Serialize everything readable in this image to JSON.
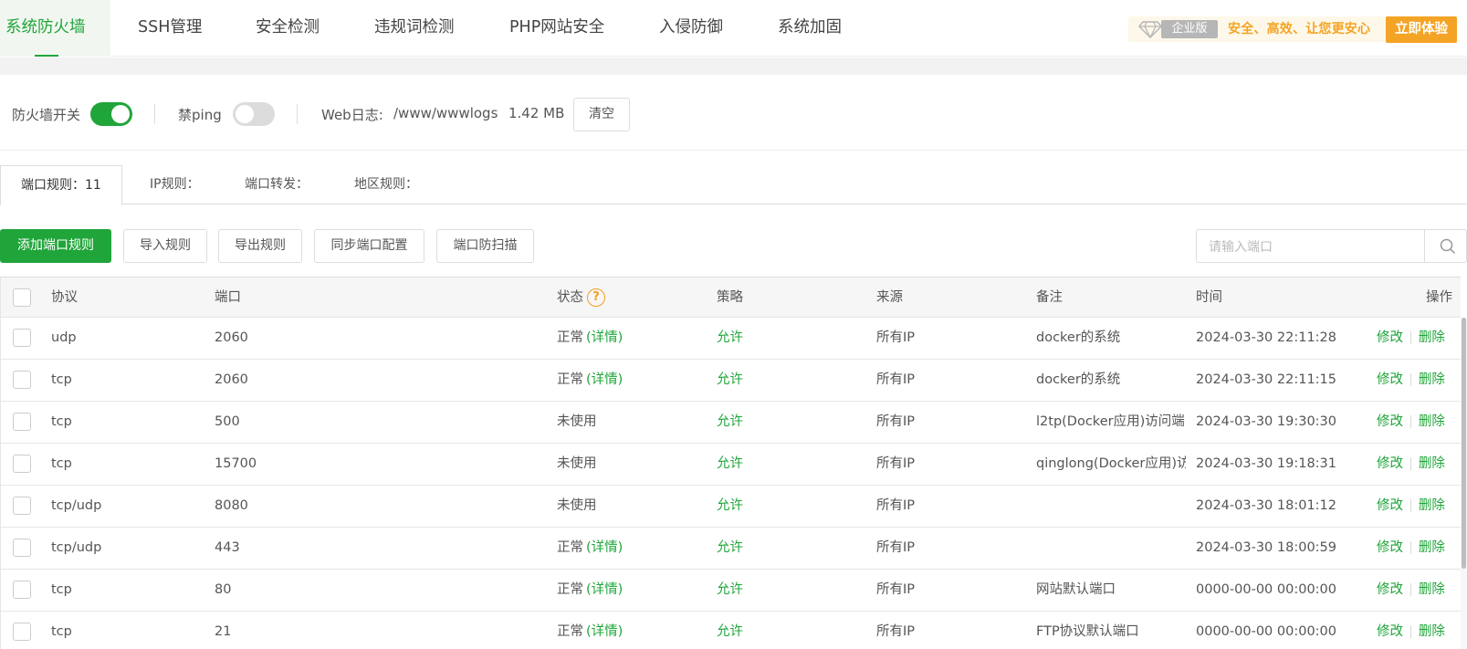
{
  "nav": {
    "tabs": [
      {
        "label": "系统防火墙",
        "active": true
      },
      {
        "label": "SSH管理"
      },
      {
        "label": "安全检测"
      },
      {
        "label": "违规词检测"
      },
      {
        "label": "PHP网站安全"
      },
      {
        "label": "入侵防御"
      },
      {
        "label": "系统加固"
      }
    ],
    "promo": {
      "edition": "企业版",
      "slogan": "安全、高效、让您更安心",
      "button": "立即体验"
    }
  },
  "settings": {
    "firewall_label": "防火墙开关",
    "firewall_on": true,
    "ping_label": "禁ping",
    "ping_on": false,
    "weblog_label": "Web日志:",
    "weblog_path": "/www/wwwlogs",
    "weblog_size": "1.42 MB",
    "clear_button": "清空"
  },
  "subtabs": [
    {
      "label": "端口规则：11",
      "active": true
    },
    {
      "label": "IP规则："
    },
    {
      "label": "端口转发："
    },
    {
      "label": "地区规则："
    }
  ],
  "actions": {
    "add": "添加端口规则",
    "import": "导入规则",
    "export": "导出规则",
    "sync": "同步端口配置",
    "scan": "端口防扫描",
    "search_placeholder": "请输入端口"
  },
  "table": {
    "headers": {
      "protocol": "协议",
      "port": "端口",
      "status": "状态",
      "status_help": "?",
      "policy": "策略",
      "source": "来源",
      "note": "备注",
      "time": "时间",
      "ops": "操作"
    },
    "ops": {
      "edit": "修改",
      "sep": "|",
      "delete": "删除"
    },
    "rows": [
      {
        "protocol": "udp",
        "port": "2060",
        "status": "正常",
        "detail": "(详情)",
        "policy": "允许",
        "source": "所有IP",
        "note": "docker的系统",
        "time": "2024-03-30 22:11:28"
      },
      {
        "protocol": "tcp",
        "port": "2060",
        "status": "正常",
        "detail": "(详情)",
        "policy": "允许",
        "source": "所有IP",
        "note": "docker的系统",
        "time": "2024-03-30 22:11:15"
      },
      {
        "protocol": "tcp",
        "port": "500",
        "status": "未使用",
        "detail": "",
        "policy": "允许",
        "source": "所有IP",
        "note": "l2tp(Docker应用)访问端",
        "time": "2024-03-30 19:30:30"
      },
      {
        "protocol": "tcp",
        "port": "15700",
        "status": "未使用",
        "detail": "",
        "policy": "允许",
        "source": "所有IP",
        "note": "qinglong(Docker应用)访",
        "time": "2024-03-30 19:18:31"
      },
      {
        "protocol": "tcp/udp",
        "port": "8080",
        "status": "未使用",
        "detail": "",
        "policy": "允许",
        "source": "所有IP",
        "note": "",
        "time": "2024-03-30 18:01:12"
      },
      {
        "protocol": "tcp/udp",
        "port": "443",
        "status": "正常",
        "detail": "(详情)",
        "policy": "允许",
        "source": "所有IP",
        "note": "",
        "time": "2024-03-30 18:00:59"
      },
      {
        "protocol": "tcp",
        "port": "80",
        "status": "正常",
        "detail": "(详情)",
        "policy": "允许",
        "source": "所有IP",
        "note": "网站默认端口",
        "time": "0000-00-00 00:00:00"
      },
      {
        "protocol": "tcp",
        "port": "21",
        "status": "正常",
        "detail": "(详情)",
        "policy": "允许",
        "source": "所有IP",
        "note": "FTP协议默认端口",
        "time": "0000-00-00 00:00:00"
      }
    ]
  },
  "colors": {
    "accent": "#20a53a",
    "promo": "#f4a425",
    "help": "#f0a020"
  }
}
